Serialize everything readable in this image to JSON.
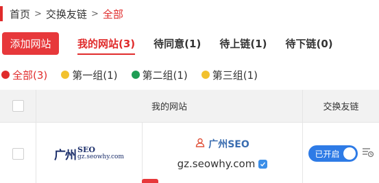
{
  "breadcrumb": {
    "home": "首页",
    "section": "交换友链",
    "current": "全部",
    "separator": ">"
  },
  "toolbar": {
    "add_label": "添加网站",
    "tabs": [
      {
        "label": "我的网站(3)",
        "active": true
      },
      {
        "label": "待同意(1)",
        "active": false
      },
      {
        "label": "待上链(1)",
        "active": false
      },
      {
        "label": "待下链(0)",
        "active": false
      }
    ]
  },
  "groups": [
    {
      "label": "全部(3)",
      "color": "#e02b2b",
      "active": true
    },
    {
      "label": "第一组(1)",
      "color": "#f2c12e",
      "active": false
    },
    {
      "label": "第二组(1)",
      "color": "#1f9d55",
      "active": false
    },
    {
      "label": "第三组(1)",
      "color": "#f2c12e",
      "active": false
    }
  ],
  "table": {
    "headers": {
      "site": "我的网站",
      "link": "交换友链"
    },
    "rows": [
      {
        "logo": {
          "mark": "广州",
          "text_big": "SEO",
          "text_small": "gz.seowhy.com"
        },
        "name": "广州SEO",
        "url": "gz.seowhy.com",
        "toggle_label": "已开启",
        "toggle_on": true
      }
    ]
  },
  "colors": {
    "accent": "#e02b2b",
    "link_blue": "#3a6db0",
    "toggle_blue": "#2e7be6"
  },
  "icons": {
    "user": "user-outline-icon",
    "verified": "verified-badge-icon",
    "list": "list-settings-icon"
  }
}
